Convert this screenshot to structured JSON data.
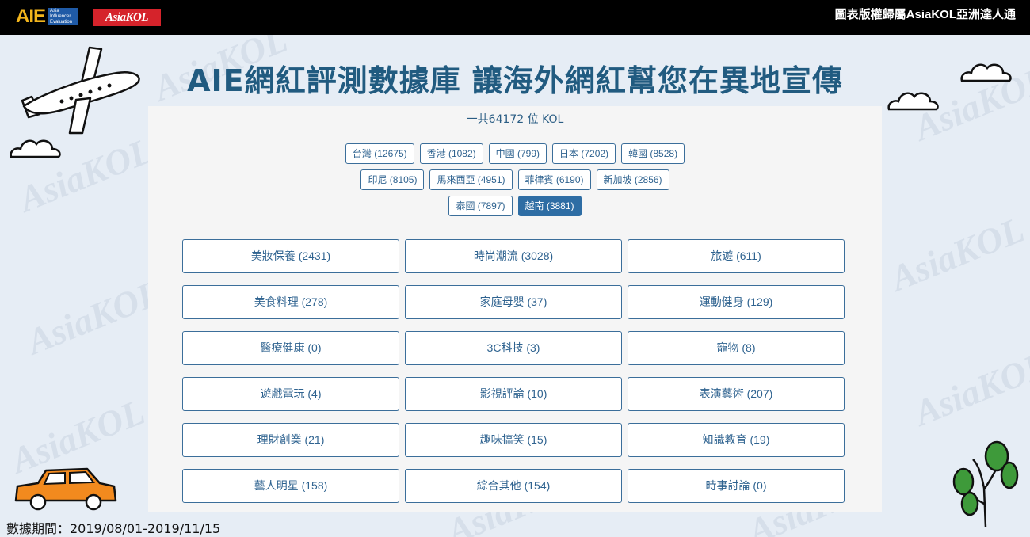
{
  "header": {
    "aie_logo_text": "AIE",
    "aie_logo_sub": "Asia Influencer Evaluation",
    "asiakol_logo_text": "AsiaKOL",
    "copyright": "圖表版權歸屬AsiaKOL亞洲達人通"
  },
  "watermark_text": "AsiaKOL",
  "page_title": "AIE網紅評測數據庫  讓海外網紅幫您在異地宣傳",
  "total_label": "一共64172 位 KOL",
  "countries": [
    [
      "台灣 (12675)",
      "香港 (1082)",
      "中國 (799)",
      "日本 (7202)",
      "韓國 (8528)"
    ],
    [
      "印尼 (8105)",
      "馬來西亞 (4951)",
      "菲律賓 (6190)",
      "新加坡 (2856)"
    ],
    [
      "泰國 (7897)",
      "越南 (3881)"
    ]
  ],
  "active_country": "越南 (3881)",
  "categories": [
    "美妝保養 (2431)",
    "時尚潮流 (3028)",
    "旅遊 (611)",
    "美食料理 (278)",
    "家庭母嬰 (37)",
    "運動健身 (129)",
    "醫療健康 (0)",
    "3C科技 (3)",
    "寵物 (8)",
    "遊戲電玩 (4)",
    "影視評論 (10)",
    "表演藝術 (207)",
    "理財創業 (21)",
    "趣味搞笑 (15)",
    "知識教育 (19)",
    "藝人明星 (158)",
    "綜合其他 (154)",
    "時事討論 (0)"
  ],
  "data_period": "數據期間：2019/08/01-2019/11/15",
  "colors": {
    "accent": "#2e6da4",
    "title": "#215b80",
    "background": "#e6edf5",
    "panel": "#f5f5f5"
  }
}
